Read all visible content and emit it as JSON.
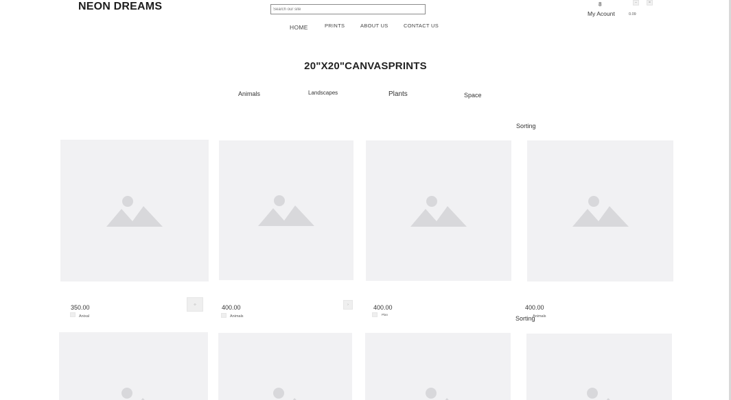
{
  "header": {
    "brand": "NEON DREAMS",
    "search_placeholder": "Search our site",
    "nav": [
      "HOME",
      "PRINTS",
      "ABOUT US",
      "CONTACT US"
    ],
    "account_count": "8",
    "account_label": "My Acount",
    "cart_value": "0.09"
  },
  "page": {
    "title": "20\"X20\"CANVASPRINTS",
    "categories": [
      "Animals",
      "Landscapes",
      "Plants",
      "Space"
    ],
    "sorting_label": "Sorting",
    "sorting_label_2": "Sorting"
  },
  "products": [
    {
      "price": "350.00",
      "tag": "Anixal"
    },
    {
      "price": "400.00",
      "tag": "Animals"
    },
    {
      "price": "400.00",
      "tag": "Plan"
    },
    {
      "price": "400.00",
      "tag": "Animals"
    }
  ],
  "icons": {
    "image_placeholder": "image-placeholder-icon",
    "image_placeholder_color": "#d8d8db",
    "tile_background": "#f1f1f3"
  }
}
